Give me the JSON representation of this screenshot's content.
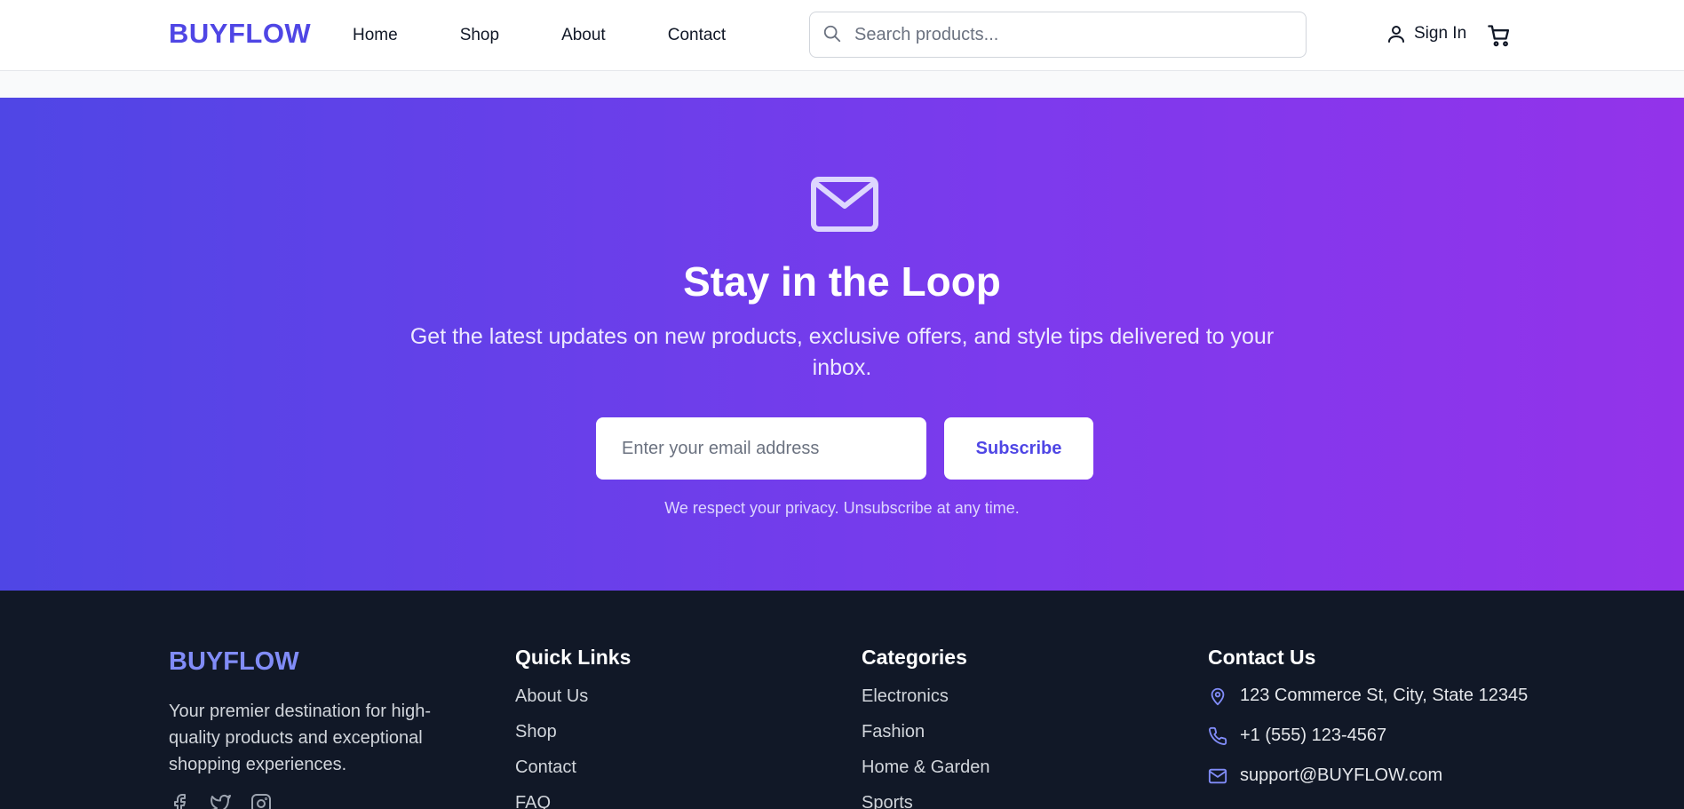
{
  "header": {
    "logo": "BUYFLOW",
    "nav": [
      "Home",
      "Shop",
      "About",
      "Contact"
    ],
    "search_placeholder": "Search products...",
    "signin_label": "Sign In"
  },
  "hero": {
    "title": "Stay in the Loop",
    "lead": "Get the latest updates on new products, exclusive offers, and style tips delivered to your inbox.",
    "email_placeholder": "Enter your email address",
    "subscribe_label": "Subscribe",
    "privacy": "We respect your privacy. Unsubscribe at any time."
  },
  "footer": {
    "logo": "BUYFLOW",
    "description": "Your premier destination for high-quality products and exceptional shopping experiences.",
    "quick_links": {
      "title": "Quick Links",
      "items": [
        "About Us",
        "Shop",
        "Contact",
        "FAQ"
      ]
    },
    "categories": {
      "title": "Categories",
      "items": [
        "Electronics",
        "Fashion",
        "Home & Garden",
        "Sports"
      ]
    },
    "contact": {
      "title": "Contact Us",
      "address": "123 Commerce St, City, State 12345",
      "phone": "+1 (555) 123-4567",
      "email": "support@BUYFLOW.com"
    }
  },
  "colors": {
    "brand": "#4f46e5",
    "gradient_start": "#4f46e5",
    "gradient_end": "#9333ea",
    "footer_bg": "#111827"
  },
  "icons": [
    "search-icon",
    "user-icon",
    "cart-icon",
    "mail-icon",
    "facebook-icon",
    "twitter-icon",
    "instagram-icon",
    "map-pin-icon",
    "phone-icon",
    "envelope-icon"
  ]
}
